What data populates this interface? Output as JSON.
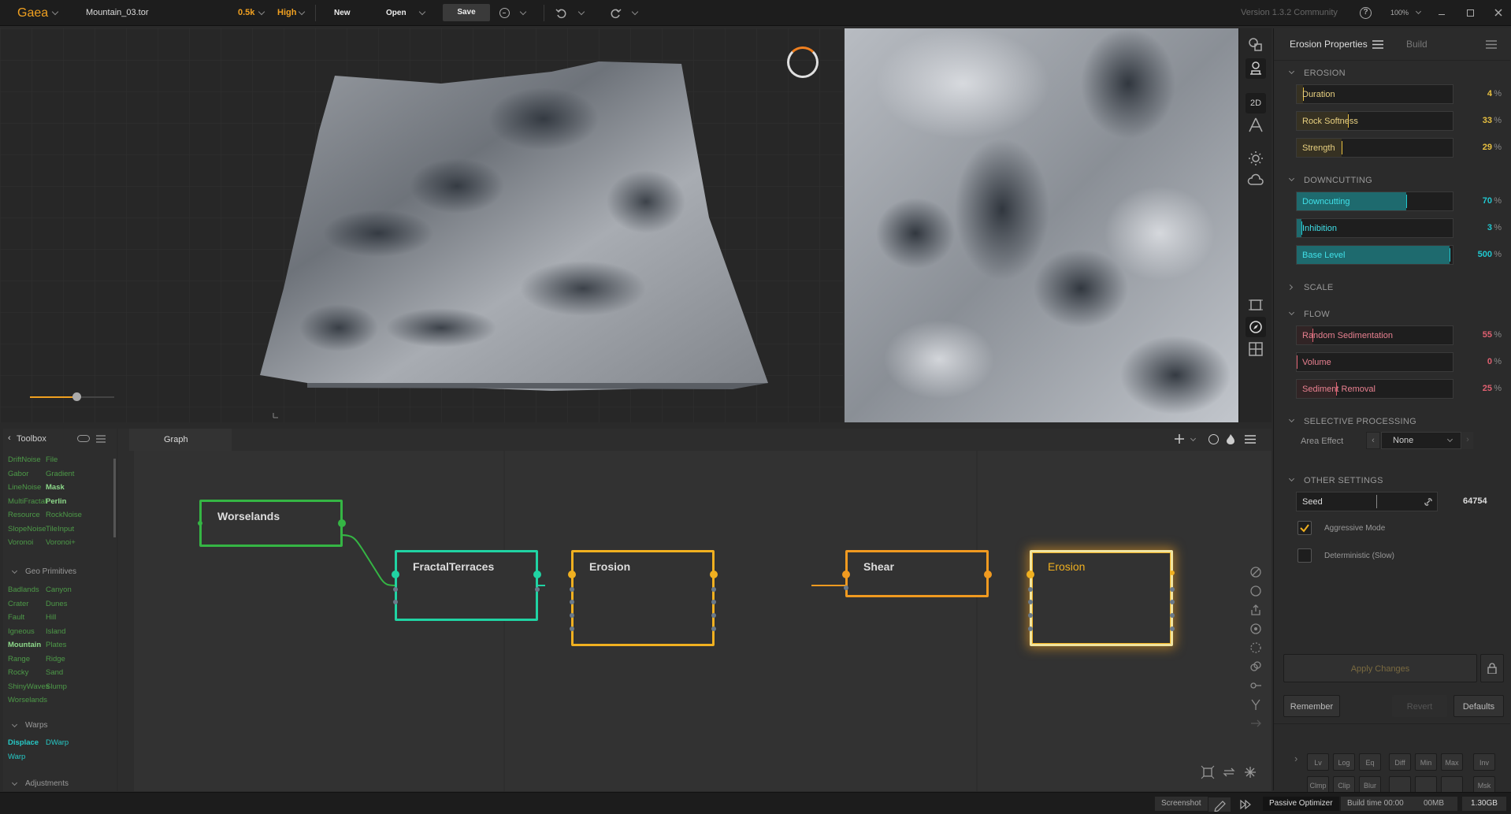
{
  "app": {
    "name": "Gaea",
    "file": "Mountain_03.tor",
    "resolution": "0.5k",
    "quality": "High",
    "version": "Version 1.3.2 Community",
    "zoom": "100%"
  },
  "toolbar": {
    "new": "New",
    "open": "Open",
    "save": "Save"
  },
  "viewport": {
    "mode_2d": "2D",
    "height_slider": 0.55
  },
  "props": {
    "tab_active": "Erosion Properties",
    "tab_build": "Build",
    "sections": {
      "erosion": "EROSION",
      "downcutting": "DOWNCUTTING",
      "scale": "SCALE",
      "flow": "FLOW",
      "selective": "SELECTIVE PROCESSING",
      "other": "OTHER SETTINGS"
    },
    "erosion": [
      {
        "label": "Duration",
        "value": "4",
        "pct": 0.04
      },
      {
        "label": "Rock Softness",
        "value": "33",
        "pct": 0.33
      },
      {
        "label": "Strength",
        "value": "29",
        "pct": 0.29
      }
    ],
    "downcutting": [
      {
        "label": "Downcutting",
        "value": "70",
        "pct": 0.7
      },
      {
        "label": "Inhibition",
        "value": "3",
        "pct": 0.03
      },
      {
        "label": "Base Level",
        "value": "500",
        "pct": 0.98
      }
    ],
    "flow": [
      {
        "label": "Random Sedimentation",
        "value": "55",
        "pct": 0.1
      },
      {
        "label": "Volume",
        "value": "0",
        "pct": 0.0
      },
      {
        "label": "Sediment Removal",
        "value": "25",
        "pct": 0.25
      }
    ],
    "percent_sign": "%",
    "area_effect_label": "Area Effect",
    "area_effect_value": "None",
    "seed_label": "Seed",
    "seed_value": "64754",
    "aggressive_label": "Aggressive Mode",
    "aggressive_checked": true,
    "deterministic_label": "Deterministic (Slow)",
    "deterministic_checked": false,
    "apply": "Apply Changes",
    "remember": "Remember",
    "revert": "Revert",
    "defaults": "Defaults",
    "quick_row1": [
      "Lv",
      "Log",
      "Eq",
      "Diff",
      "Min",
      "Max",
      "Inv"
    ],
    "quick_row2": [
      "Clmp",
      "Clip",
      "Blur",
      "",
      "",
      "",
      "Msk"
    ]
  },
  "toolbox": {
    "title": "Toolbox",
    "primitives": [
      [
        "DriftNoise",
        "File"
      ],
      [
        "Gabor",
        "Gradient"
      ],
      [
        "LineNoise",
        "Mask"
      ],
      [
        "MultiFractal",
        "Perlin"
      ],
      [
        "Resource",
        "RockNoise"
      ],
      [
        "SlopeNoise",
        "TileInput"
      ],
      [
        "Voronoi",
        "Voronoi+"
      ]
    ],
    "geo_title": "Geo Primitives",
    "geo": [
      [
        "Badlands",
        "Canyon"
      ],
      [
        "Crater",
        "Dunes"
      ],
      [
        "Fault",
        "Hill"
      ],
      [
        "Igneous",
        "Island"
      ],
      [
        "Mountain",
        "Plates"
      ],
      [
        "Range",
        "Ridge"
      ],
      [
        "Rocky",
        "Sand"
      ],
      [
        "ShinyWaves",
        "Slump"
      ],
      [
        "Worselands",
        ""
      ]
    ],
    "warps_title": "Warps",
    "warps": [
      [
        "Displace",
        "DWarp"
      ],
      [
        "Warp",
        ""
      ]
    ],
    "adjust_title": "Adjustments"
  },
  "graph": {
    "tab": "Graph",
    "nodes": [
      {
        "id": "worselands",
        "title": "Worselands",
        "color": "#35b544"
      },
      {
        "id": "fractal",
        "title": "FractalTerraces",
        "color": "#20d3a3"
      },
      {
        "id": "erosion1",
        "title": "Erosion",
        "color": "#f0b020"
      },
      {
        "id": "shear",
        "title": "Shear",
        "color": "#f09a20"
      },
      {
        "id": "erosion2",
        "title": "Erosion",
        "color": "#f0b020"
      }
    ]
  },
  "status": {
    "screenshot": "Screenshot",
    "optimizer": "Passive Optimizer",
    "build_time": "Build time 00:00",
    "mem1": "00MB",
    "mem2": "1.30GB"
  }
}
